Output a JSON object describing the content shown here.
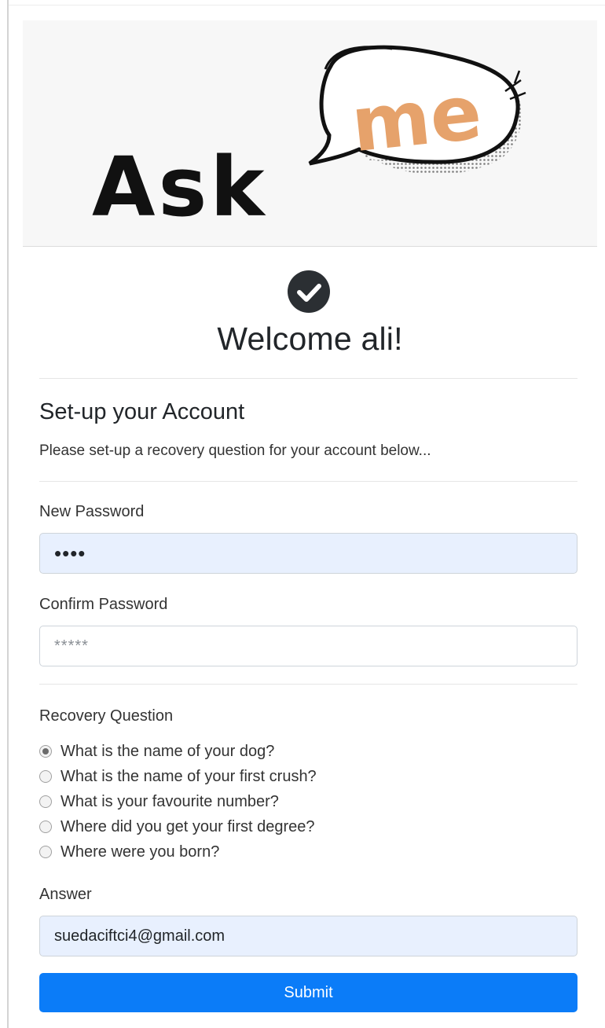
{
  "header": {
    "logo_text_ask": "Ask",
    "logo_text_me": "me",
    "brand_dark": "#111111",
    "brand_accent": "#e6a26b"
  },
  "welcome": {
    "icon": "check-circle-icon",
    "title": "Welcome ali!"
  },
  "setup": {
    "title": "Set-up your Account",
    "subtitle": "Please set-up a recovery question for your account below..."
  },
  "form": {
    "new_password": {
      "label": "New Password",
      "value": "••••"
    },
    "confirm_password": {
      "label": "Confirm Password",
      "placeholder": "*****",
      "value": ""
    },
    "recovery": {
      "label": "Recovery Question",
      "options": [
        {
          "label": "What is the name of your dog?",
          "checked": true
        },
        {
          "label": "What is the name of your first crush?",
          "checked": false
        },
        {
          "label": "What is your favourite number?",
          "checked": false
        },
        {
          "label": "Where did you get your first degree?",
          "checked": false
        },
        {
          "label": "Where were you born?",
          "checked": false
        }
      ]
    },
    "answer": {
      "label": "Answer",
      "value": "suedaciftci4@gmail.com"
    },
    "submit_label": "Submit"
  },
  "colors": {
    "primary": "#0b7cf8",
    "autofill": "#e8f0fe"
  }
}
